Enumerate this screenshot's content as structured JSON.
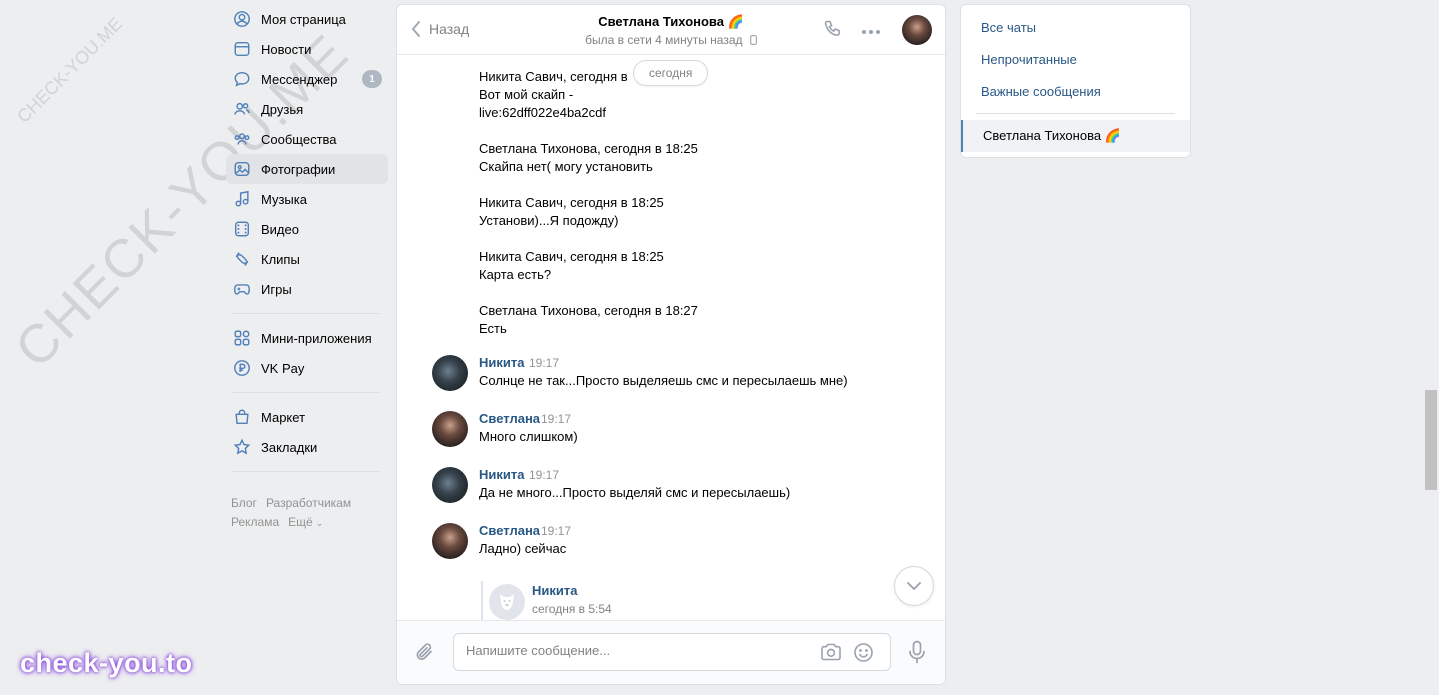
{
  "nav": {
    "items": [
      {
        "label": "Моя страница",
        "icon": "user-circle-icon"
      },
      {
        "label": "Новости",
        "icon": "newspaper-icon"
      },
      {
        "label": "Мессенджер",
        "icon": "message-icon",
        "badge": "1"
      },
      {
        "label": "Друзья",
        "icon": "friends-icon"
      },
      {
        "label": "Сообщества",
        "icon": "communities-icon"
      },
      {
        "label": "Фотографии",
        "icon": "photo-icon",
        "active": true
      },
      {
        "label": "Музыка",
        "icon": "music-icon"
      },
      {
        "label": "Видео",
        "icon": "video-icon"
      },
      {
        "label": "Клипы",
        "icon": "clips-icon"
      },
      {
        "label": "Игры",
        "icon": "gamepad-icon"
      }
    ],
    "items2": [
      {
        "label": "Мини-приложения",
        "icon": "apps-icon"
      },
      {
        "label": "VK Pay",
        "icon": "vkpay-icon"
      }
    ],
    "items3": [
      {
        "label": "Маркет",
        "icon": "bag-icon"
      },
      {
        "label": "Закладки",
        "icon": "star-icon"
      }
    ],
    "footer": {
      "blog": "Блог",
      "dev": "Разработчикам",
      "ads": "Реклама",
      "more": "Ещё"
    }
  },
  "watermark": {
    "big": "CHECK-YOU.ME",
    "small": "CHECK-YOU.ME",
    "brand": "check-you.to"
  },
  "chat": {
    "back_label": "Назад",
    "title": "Светлана Тихонова 🌈",
    "status": "была в сети 4 минуты назад",
    "date_pill": "сегодня",
    "forwarded": [
      {
        "header": "Никита Савич, сегодня в",
        "lines": [
          "Вот мой скайп -",
          "live:62dff022e4ba2cdf"
        ]
      },
      {
        "header": "Светлана Тихонова, сегодня в 18:25",
        "lines": [
          "Скайпа нет( могу установить"
        ]
      },
      {
        "header": "Никита Савич, сегодня в 18:25",
        "lines": [
          "Установи)...Я подожду)"
        ]
      },
      {
        "header": "Никита Савич, сегодня в 18:25",
        "lines": [
          "Карта есть?"
        ]
      },
      {
        "header": "Светлана Тихонова, сегодня в 18:27",
        "lines": [
          "Есть"
        ]
      }
    ],
    "messages": [
      {
        "author": "Никита",
        "time": "19:17",
        "text": "Солнце не так...Просто выделяешь смс и пересылаешь мне)"
      },
      {
        "author": "Светлана",
        "time": "19:17",
        "text": "Много слишком)"
      },
      {
        "author": "Никита",
        "time": "19:17",
        "text": "Да не много...Просто выделяй смс и пересылаешь)"
      },
      {
        "author": "Светлана",
        "time": "19:17",
        "text": "Ладно) сейчас"
      }
    ],
    "quote": {
      "name": "Никита",
      "time": "сегодня в 5:54"
    },
    "composer_placeholder": "Напишите сообщение..."
  },
  "right": {
    "all_chats": "Все чаты",
    "unread": "Непрочитанные",
    "important": "Важные сообщения",
    "current_chat": "Светлана Тихонова 🌈"
  }
}
